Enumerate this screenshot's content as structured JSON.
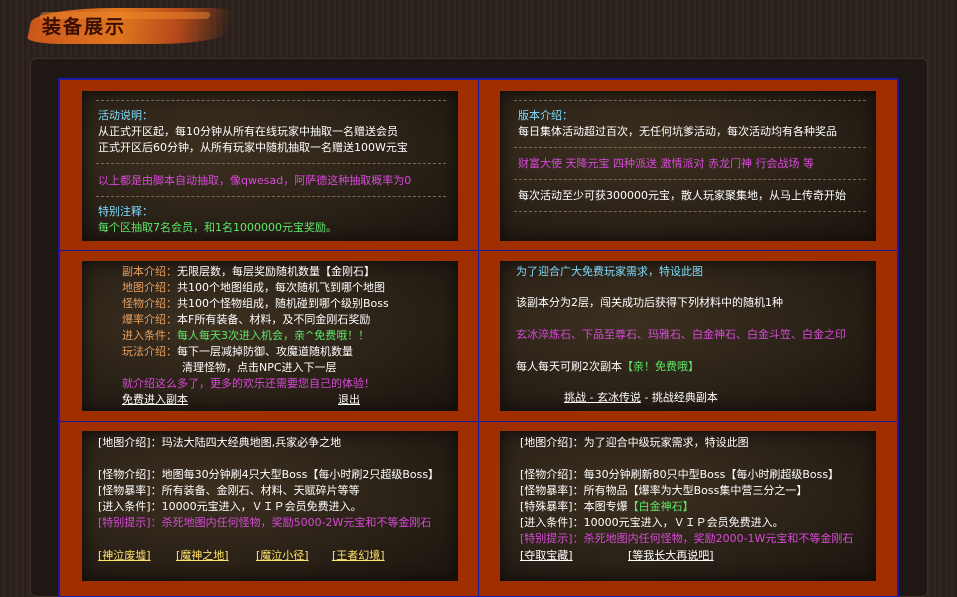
{
  "header": {
    "title": "装备展示"
  },
  "panels": {
    "p1": {
      "h1": "活动说明：",
      "l1": "从正式开区起，每10分钟从所有在线玩家中抽取一名赠送会员",
      "l2": "正式开区后60分钟，从所有玩家中随机抽取一名赠送100W元宝",
      "l3": "以上都是由脚本自动抽取，像qwesad，阿萨德这种抽取概率为0",
      "h2": "特别注释：",
      "l4": "每个区抽取7名会员，和1名1000000元宝奖励。"
    },
    "p2": {
      "h1": "版本介绍：",
      "l1": "每日集体活动超过百次，无任何坑爹活动，每次活动均有各种奖品",
      "l2": "财富大使  天降元宝  四种派送  激情派对  赤龙门神  行会战场    等",
      "l3": "每次活动至少可获300000元宝，散人玩家聚集地，从马上传奇开始"
    },
    "p3": {
      "rows": [
        {
          "label": "副本介绍：",
          "text": "无限层数，每层奖励随机数量【金刚石】"
        },
        {
          "label": "地图介绍：",
          "text": "共100个地图组成，每次随机飞到哪个地图"
        },
        {
          "label": "怪物介绍：",
          "text": "共100个怪物组成，随机碰到哪个级别Boss"
        },
        {
          "label": "爆率介绍：",
          "text": "本F所有装备、材料，及不同金刚石奖励"
        },
        {
          "label": "进入条件：",
          "text": "每人每天3次进入机会，亲^免费哦！！"
        },
        {
          "label": "玩法介绍：",
          "text": "每下一层减掉防御、攻魔道随机数量"
        }
      ],
      "cont": "清理怪物，点击NPC进入下一层",
      "note": "就介绍这么多了，更多的欢乐还需要您自己的体验！",
      "link1": "免费进入副本",
      "link2": "退出"
    },
    "p4": {
      "l1": "为了迎合广大免费玩家需求，特设此图",
      "l2": "该副本分为2层，闯关成功后获得下列材料中的随机1种",
      "l3": "玄冰淬炼石、下品至尊石、玛雅石、白金神石、白金斗笠、白金之印",
      "l4a": "每人每天可刷2次副本",
      "l4b": "【亲！免费哦】",
      "link": "挑战 - 玄冰传说",
      "l5": "- 挑战经典副本"
    },
    "p5": {
      "l1": "[地图介绍]：玛法大陆四大经典地图,兵家必争之地",
      "l2": "[怪物介绍]：地图每30分钟刷4只大型Boss【每小时刷2只超级Boss】",
      "l3": "[怪物暴率]：所有装备、金刚石、材料、天赋碎片等等",
      "l4": "[进入条件]：10000元宝进入，ＶＩＰ会员免费进入。",
      "l5": "[特别提示]：杀死地图内任何怪物，奖励5000-2W元宝和不等金刚石",
      "links": [
        "[神泣废墟]",
        "[魔神之地]",
        "[魔泣小径]",
        "[王者幻境]"
      ]
    },
    "p6": {
      "l1": "[地图介绍]：为了迎合中级玩家需求，特设此图",
      "l2": "[怪物介绍]：每30分钟刷新80只中型Boss【每小时刷超级Boss】",
      "l3": "[怪物暴率]：所有物品【爆率为大型Boss集中营三分之一】",
      "l4a": "[特殊暴率]：本图专爆",
      "l4b": "【白金神石】",
      "l5": "[进入条件]：10000元宝进入，ＶＩＰ会员免费进入。",
      "l6": "[特别提示]：杀死地图内任何怪物，奖励2000-1W元宝和不等金刚石",
      "links": [
        "[夺取宝藏]",
        "[等我长大再说吧]"
      ]
    }
  },
  "colors": {
    "accent": "#9f2e00",
    "border": "#1a1aa5",
    "cyan": "#7fdcff",
    "magenta": "#d84ad8",
    "green": "#5fe86a",
    "yellow": "#ffe36a"
  }
}
